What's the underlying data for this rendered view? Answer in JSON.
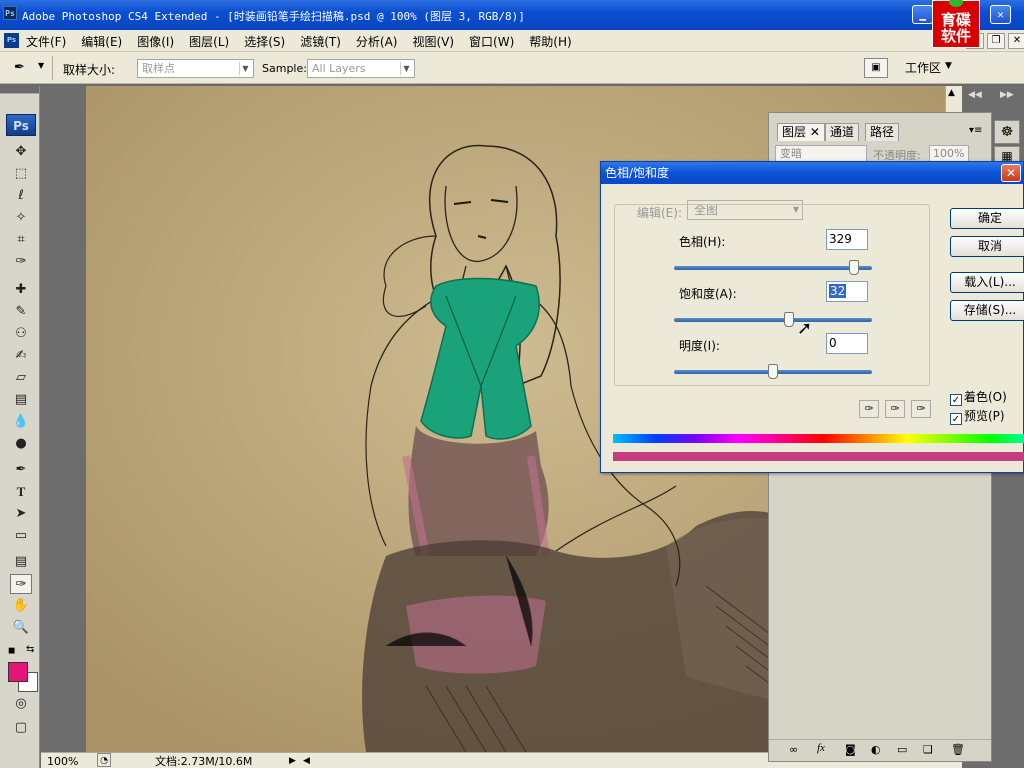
{
  "window": {
    "title": "Adobe Photoshop CS4 Extended - [时装画铅笔手绘扫描稿.psd @ 100% (图层 3, RGB/8)]",
    "app_icon": "Ps",
    "controls": [
      "minimize",
      "maximize",
      "close"
    ]
  },
  "watermark": {
    "line1": "育碟",
    "line2": "软件"
  },
  "menu": {
    "doc_icon": "Ps",
    "items": [
      "文件(F)",
      "编辑(E)",
      "图像(I)",
      "图层(L)",
      "选择(S)",
      "滤镜(T)",
      "分析(A)",
      "视图(V)",
      "窗口(W)",
      "帮助(H)"
    ]
  },
  "options": {
    "sample_size_label": "取样大小:",
    "sample_size_value": "取样点",
    "sample_label": "Sample:",
    "sample_value": "All Layers",
    "workspace_label": "工作区"
  },
  "toolbox": {
    "logo": "Ps",
    "tools": [
      "move-icon",
      "marquee-icon",
      "lasso-icon",
      "magic-wand-icon",
      "crop-icon",
      "eyedropper-icon",
      "healing-icon",
      "brush-icon",
      "stamp-icon",
      "history-brush-icon",
      "eraser-icon",
      "gradient-icon",
      "blur-icon",
      "dodge-icon",
      "pen-icon",
      "type-icon",
      "path-select-icon",
      "shape-icon",
      "notes-icon",
      "eyedropper-icon",
      "hand-icon",
      "zoom-icon"
    ],
    "type_glyph": "T",
    "foreground_color": "#e8147a",
    "background_color": "#ffffff"
  },
  "status": {
    "zoom": "100%",
    "doc_info": "文档:2.73M/10.6M"
  },
  "layers_panel": {
    "tabs": [
      "图层",
      "通道",
      "路径"
    ],
    "blend_mode": "变暗",
    "opacity_label": "不透明度:",
    "opacity_value": "100%"
  },
  "dialog": {
    "title": "色相/饱和度",
    "edit_label": "编辑(E):",
    "edit_value": "全图",
    "hue_label": "色相(H):",
    "hue_value": "329",
    "saturation_label": "饱和度(A):",
    "saturation_value": "32",
    "lightness_label": "明度(I):",
    "lightness_value": "0",
    "ok": "确定",
    "cancel": "取消",
    "load": "载入(L)...",
    "save": "存储(S)...",
    "colorize_label": "着色(O)",
    "colorize_checked": true,
    "preview_label": "预览(P)",
    "preview_checked": true,
    "hue_slider": 0.91,
    "saturation_slider": 0.58,
    "lightness_slider": 0.5
  },
  "colors": {
    "accent_green": "#1aa37a",
    "accent_pink": "#c06f8f",
    "title_blue": "#0c53d6"
  }
}
